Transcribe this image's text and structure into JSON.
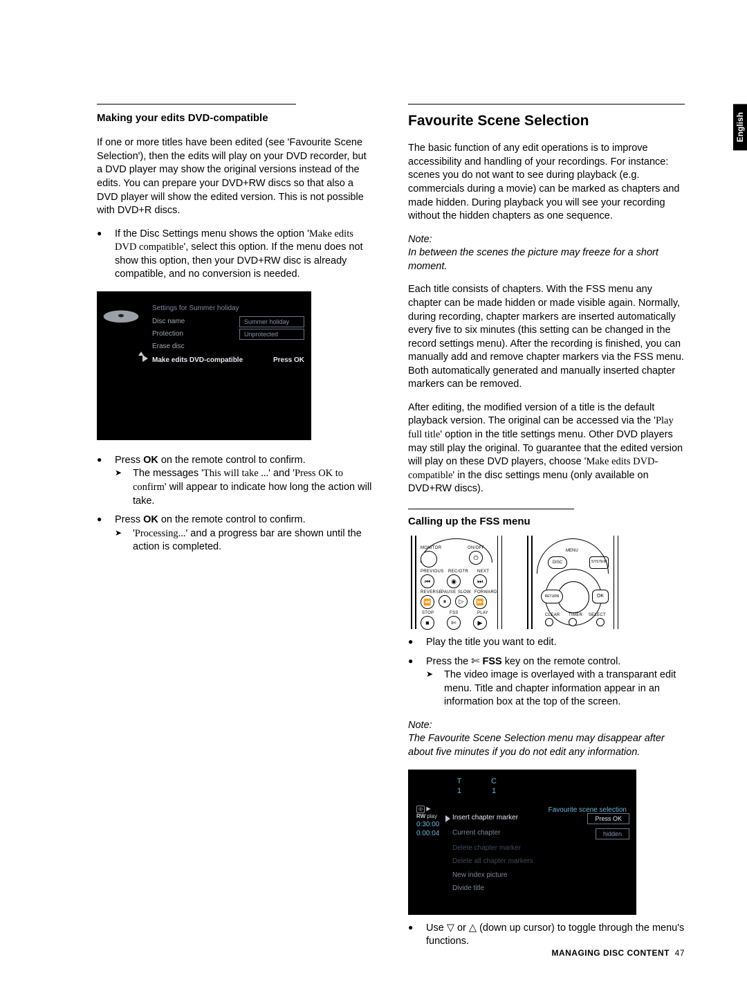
{
  "language_tab": "English",
  "left": {
    "h2": "Making your edits DVD-compatible",
    "p1": "If one or more titles have been edited (see 'Favourite Scene Selection'), then the edits will play on your DVD recorder, but a DVD player may show the original versions instead of the edits. You can prepare your DVD+RW discs so that also a DVD player will show the edited version. This is not possible with DVD+R discs.",
    "b1a": "If the Disc Settings menu shows the option '",
    "b1b": "Make edits DVD compatible",
    "b1c": "', select this option. If the menu does not show this option, then your DVD+RW disc is already compatible, and no conversion is needed.",
    "osd": {
      "title": "Settings for Summer holiday",
      "r1l": "Disc name",
      "r1v": "Summer holiday",
      "r2l": "Protection",
      "r2v": "Unprotected",
      "r3l": "Erase disc",
      "r4l": "Make edits DVD-compatible",
      "r4v": "Press OK"
    },
    "b2a": "Press ",
    "b2ok": "OK",
    "b2b": " on the remote control to confirm.",
    "b2s1a": "The messages '",
    "b2s1b": "This will take ...",
    "b2s1c": "' and '",
    "b2s1d": "Press OK to confirm",
    "b2s1e": "' will appear to indicate how long the action will take.",
    "b3a": "Press ",
    "b3ok": "OK",
    "b3b": " on the remote control to confirm.",
    "b3s1a": "'",
    "b3s1b": "Processing...",
    "b3s1c": "' and a progress bar are shown until the action is completed."
  },
  "right": {
    "h1": "Favourite Scene Selection",
    "p1": "The basic function of any edit operations is to improve accessibility and handling of your recordings. For instance: scenes you do not want to see during playback (e.g. commercials during a movie) can be marked as chapters and made hidden. During playback you will see your recording without the hidden chapters as one sequence.",
    "note1_label": "Note:",
    "note1": "In between the scenes the picture may freeze for a short moment.",
    "p2": "Each title consists of chapters. With the FSS menu any chapter can be made hidden or made visible again. Normally, during recording, chapter markers are inserted automatically every five to six minutes (this setting can be changed in the record settings menu). After the recording is finished, you can manually add and remove chapter markers via the FSS menu. Both automatically generated and manually inserted chapter markers can be removed.",
    "p3a": "After editing, the modified version of a title is the default playback version. The original can be accessed via the '",
    "p3b": "Play full title",
    "p3c": "' option in the title settings menu. Other DVD players may still play the original. To guarantee that the edited version will play on these DVD players, choose '",
    "p3d": "Make edits DVD-compatible",
    "p3e": "' in the disc settings menu (only available on DVD+RW discs).",
    "h3": "Calling up the FSS menu",
    "rem_labels": {
      "monitor": "MONITOR",
      "onoff": "ON/OFF",
      "previous": "PREVIOUS",
      "recotr": "REC/OTR",
      "next": "NEXT",
      "reverse": "REVERSE",
      "pause": "PAUSE",
      "slow": "SLOW",
      "forward": "FORWARD",
      "stop": "STOP",
      "fss": "FSS",
      "play": "PLAY",
      "menu": "MENU",
      "disc": "DISC",
      "system": "SYSTEM",
      "return": "RETURN",
      "ok": "OK",
      "clear": "CLEAR",
      "timer": "TIMER",
      "select": "SELECT"
    },
    "b1": "Play the title you want to edit.",
    "b2a": "Press the ",
    "b2fss": "FSS",
    "b2b": " key on the remote control.",
    "b2s": "The video image is overlayed with a transparant edit menu. Title and chapter information appear in an information box at the top of the screen.",
    "note2_label": "Note:",
    "note2": "The Favourite Scene Selection menu may disappear after about five minutes if you do not edit any information.",
    "osd2": {
      "T": "T",
      "C": "C",
      "t": "1",
      "c": "1",
      "rw": "RW",
      "play": "play",
      "total": "0:30:00",
      "elapsed": "0:00:04",
      "hdr": "Favourite scene selection",
      "r1": "Insert chapter marker",
      "r1v": "Press OK",
      "r2": "Current chapter",
      "r2v": "hidden",
      "r3": "Delete chapter marker",
      "r4": "Delete all chapter markers",
      "r5": "New index picture",
      "r6": "Divide title"
    },
    "b3": "Use ▽ or △ (down up cursor) to toggle through the menu's functions."
  },
  "footer": {
    "label": "MANAGING DISC CONTENT",
    "page": "47"
  },
  "icons": {
    "scissors": "✄"
  }
}
